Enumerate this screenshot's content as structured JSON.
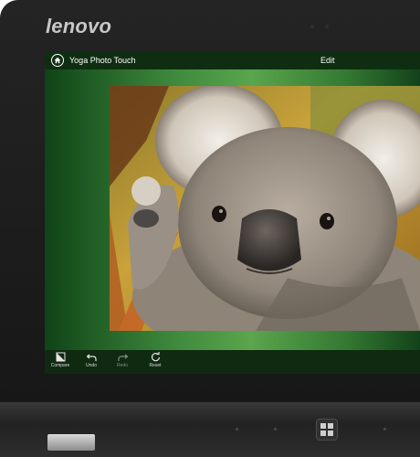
{
  "device": {
    "brand_logo": "lenovo",
    "colors": {
      "bezel": "#1c1c1c",
      "logo": "#c8c8c8",
      "app_green": "#3f8a3d"
    }
  },
  "app": {
    "title": "Yoga Photo Touch",
    "mode_label": "Edit",
    "home_icon": "home-icon"
  },
  "photo": {
    "subject": "koala"
  },
  "toolbar": {
    "items": [
      {
        "label": "Compare",
        "icon": "compare-icon",
        "enabled": true
      },
      {
        "label": "Undo",
        "icon": "undo-icon",
        "enabled": true
      },
      {
        "label": "Redo",
        "icon": "redo-icon",
        "enabled": false
      },
      {
        "label": "Reset",
        "icon": "reset-icon",
        "enabled": true
      }
    ]
  },
  "hardware": {
    "windows_button_icon": "windows-logo-icon"
  }
}
